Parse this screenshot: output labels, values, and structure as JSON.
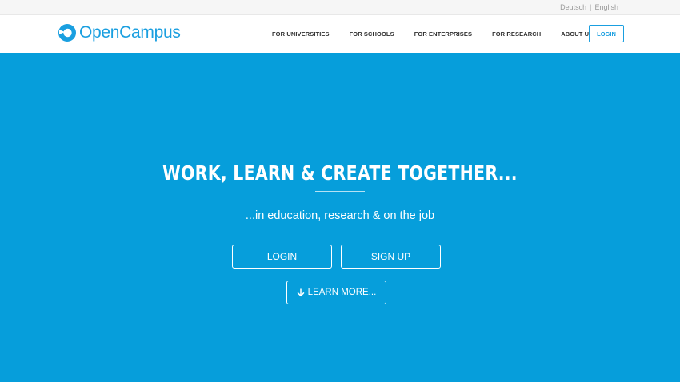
{
  "lang": {
    "de": "Deutsch",
    "sep": "|",
    "en": "English"
  },
  "brand": {
    "name": "OpenCampus",
    "color": "#1a9fe0"
  },
  "nav": {
    "items": [
      {
        "label": "FOR UNIVERSITIES"
      },
      {
        "label": "FOR SCHOOLS"
      },
      {
        "label": "FOR ENTERPRISES"
      },
      {
        "label": "FOR RESEARCH"
      },
      {
        "label": "ABOUT US"
      }
    ],
    "login": "LOGIN"
  },
  "hero": {
    "background": "#069edb",
    "title": "WORK, LEARN & CREATE TOGETHER...",
    "subtitle": "...in education, research & on the job",
    "login": "LOGIN",
    "signup": "SIGN UP",
    "learn_more": "LEARN MORE...",
    "learn_more_icon": "arrow-down-icon"
  }
}
